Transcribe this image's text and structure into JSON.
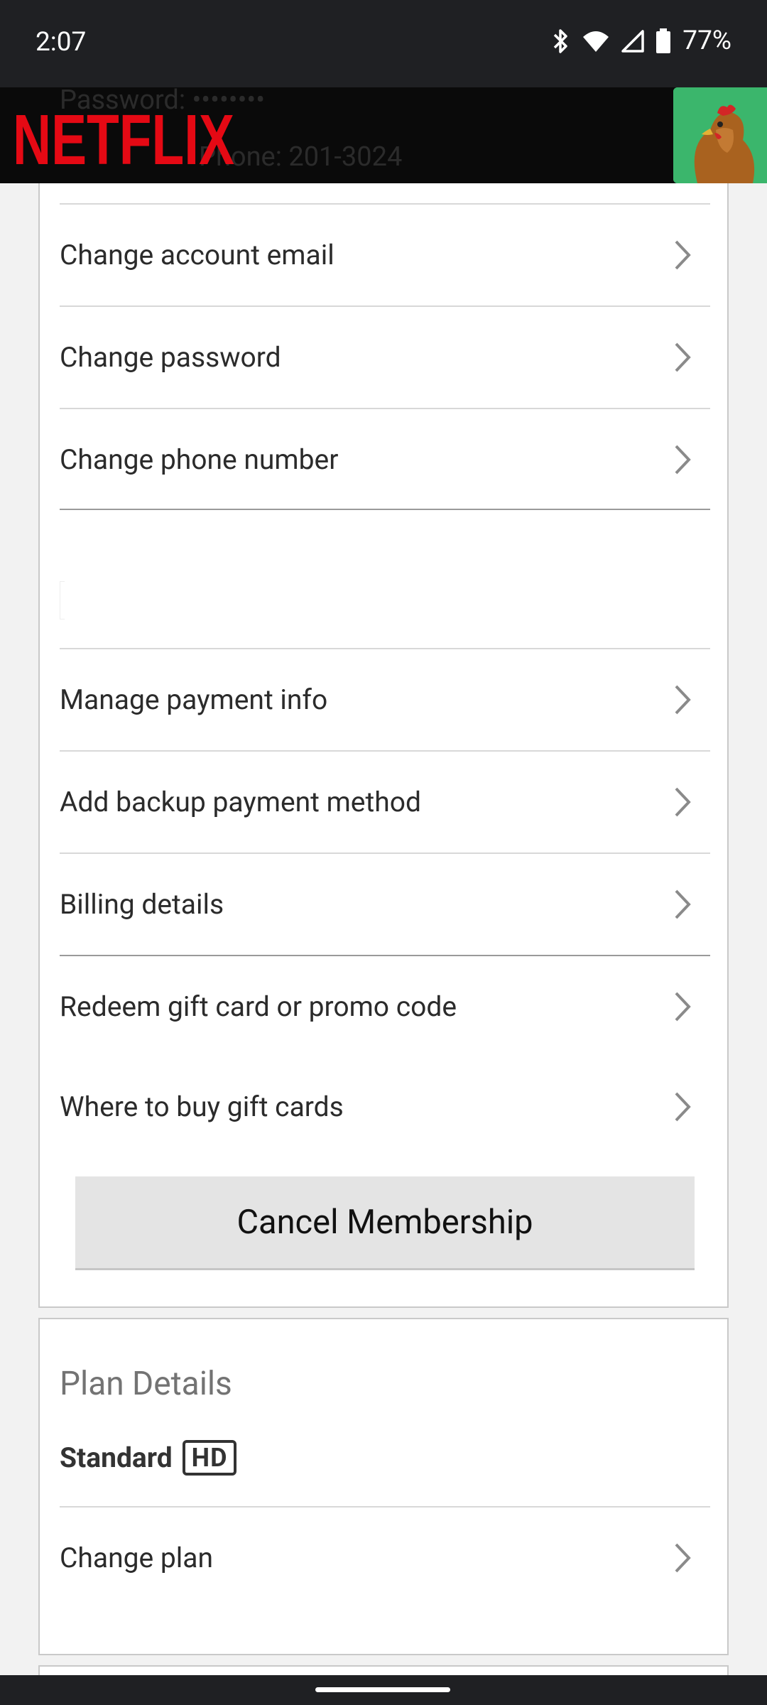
{
  "status": {
    "time": "2:07",
    "battery": "77%"
  },
  "header": {
    "logo_text": "NETFLIX",
    "behind_text_1": "Password: ••••••••",
    "behind_text_2": "Phone: 201-3024",
    "avatar_icon": "chicken-avatar-icon"
  },
  "account_rows": [
    {
      "label": "Change account email"
    },
    {
      "label": "Change password"
    },
    {
      "label": "Change phone number"
    }
  ],
  "billing_rows": [
    {
      "label": "Manage payment info"
    },
    {
      "label": "Add backup payment method"
    },
    {
      "label": "Billing details"
    }
  ],
  "gift_rows": [
    {
      "label": "Redeem gift card or promo code"
    },
    {
      "label": "Where to buy gift cards"
    }
  ],
  "cancel_button": {
    "label": "Cancel Membership"
  },
  "plan": {
    "section_title": "Plan Details",
    "plan_name": "Standard",
    "badge": "HD",
    "change_label": "Change plan"
  },
  "colors": {
    "brand_red": "#e50914",
    "header_bg": "#0a0a0a",
    "avatar_bg": "#39b66b"
  }
}
